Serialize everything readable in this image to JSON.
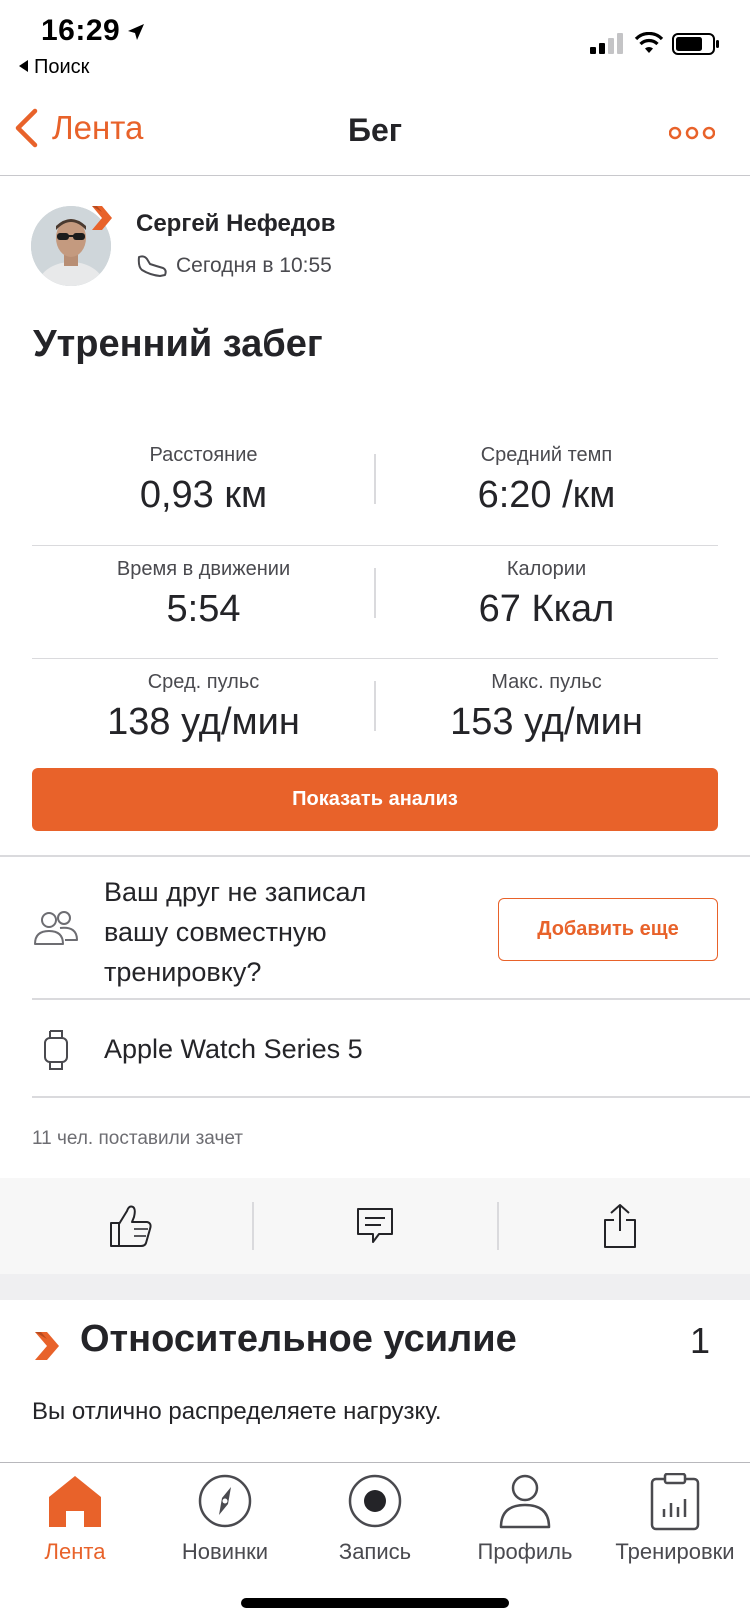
{
  "status_bar": {
    "time": "16:29",
    "back_app": "Поиск"
  },
  "nav": {
    "back_label": "Лента",
    "title": "Бег"
  },
  "athlete": {
    "name": "Сергей Нефедов",
    "timestamp": "Сегодня в 10:55"
  },
  "activity": {
    "title": "Утренний забег"
  },
  "stats": [
    {
      "left": {
        "label": "Расстояние",
        "value": "0,93 км"
      },
      "right": {
        "label": "Средний темп",
        "value": "6:20 /км"
      }
    },
    {
      "left": {
        "label": "Время в движении",
        "value": "5:54"
      },
      "right": {
        "label": "Калории",
        "value": "67 Ккал"
      }
    },
    {
      "left": {
        "label": "Сред. пульс",
        "value": "138 уд/мин"
      },
      "right": {
        "label": "Макс. пульс",
        "value": "153 уд/мин"
      }
    }
  ],
  "analyze_button": "Показать анализ",
  "friend_prompt": {
    "text": "Ваш друг не записал вашу совместную тренировку?",
    "button": "Добавить еще"
  },
  "device": {
    "name": "Apple Watch Series 5"
  },
  "kudos": {
    "text": "11 чел. поставили зачет"
  },
  "relative_effort": {
    "title": "Относительное усилие",
    "value": "1",
    "description": "Вы отлично распределяете нагрузку."
  },
  "tabs": [
    {
      "label": "Лента",
      "icon": "home-icon",
      "active": true
    },
    {
      "label": "Новинки",
      "icon": "compass-icon",
      "active": false
    },
    {
      "label": "Запись",
      "icon": "record-icon",
      "active": false
    },
    {
      "label": "Профиль",
      "icon": "profile-icon",
      "active": false
    },
    {
      "label": "Тренировки",
      "icon": "training-icon",
      "active": false
    }
  ],
  "colors": {
    "accent": "#e8622a",
    "text": "#242428",
    "muted": "#4a4a4f"
  }
}
